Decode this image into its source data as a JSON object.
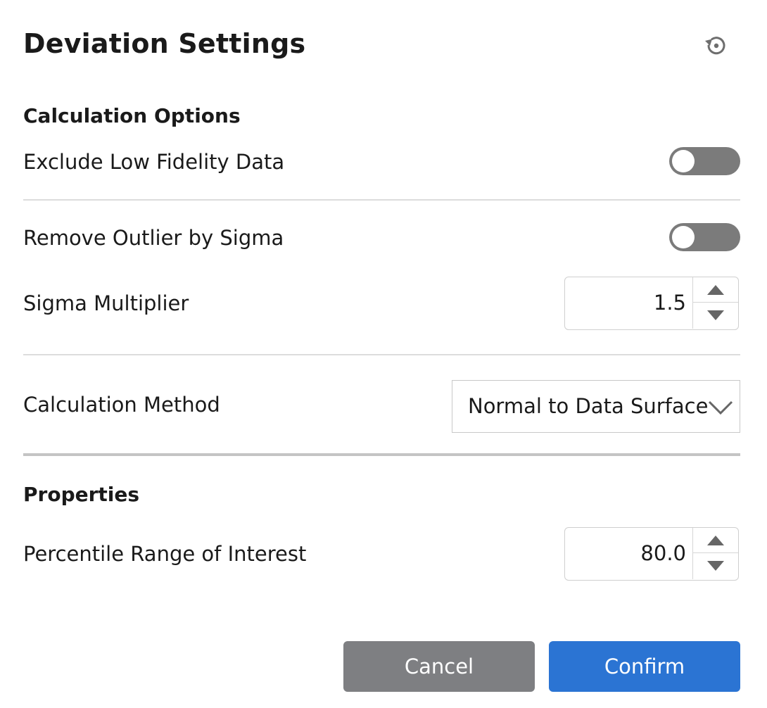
{
  "dialog": {
    "title": "Deviation Settings",
    "reset_icon": "reset-icon"
  },
  "calculation_options": {
    "heading": "Calculation Options",
    "exclude_low_fidelity": {
      "label": "Exclude Low Fidelity Data",
      "enabled": false
    },
    "remove_outlier": {
      "label": "Remove Outlier by Sigma",
      "enabled": false
    },
    "sigma_multiplier": {
      "label": "Sigma Multiplier",
      "value": "1.5"
    },
    "calculation_method": {
      "label": "Calculation Method",
      "selected": "Normal to Data Surface"
    }
  },
  "properties": {
    "heading": "Properties",
    "percentile_range": {
      "label": "Percentile Range of Interest",
      "value": "80.0"
    }
  },
  "footer": {
    "cancel_label": "Cancel",
    "confirm_label": "Confirm"
  },
  "colors": {
    "toggle_off": "#7b7b7b",
    "cancel_bg": "#7e7f82",
    "confirm_bg": "#2b74d3"
  }
}
